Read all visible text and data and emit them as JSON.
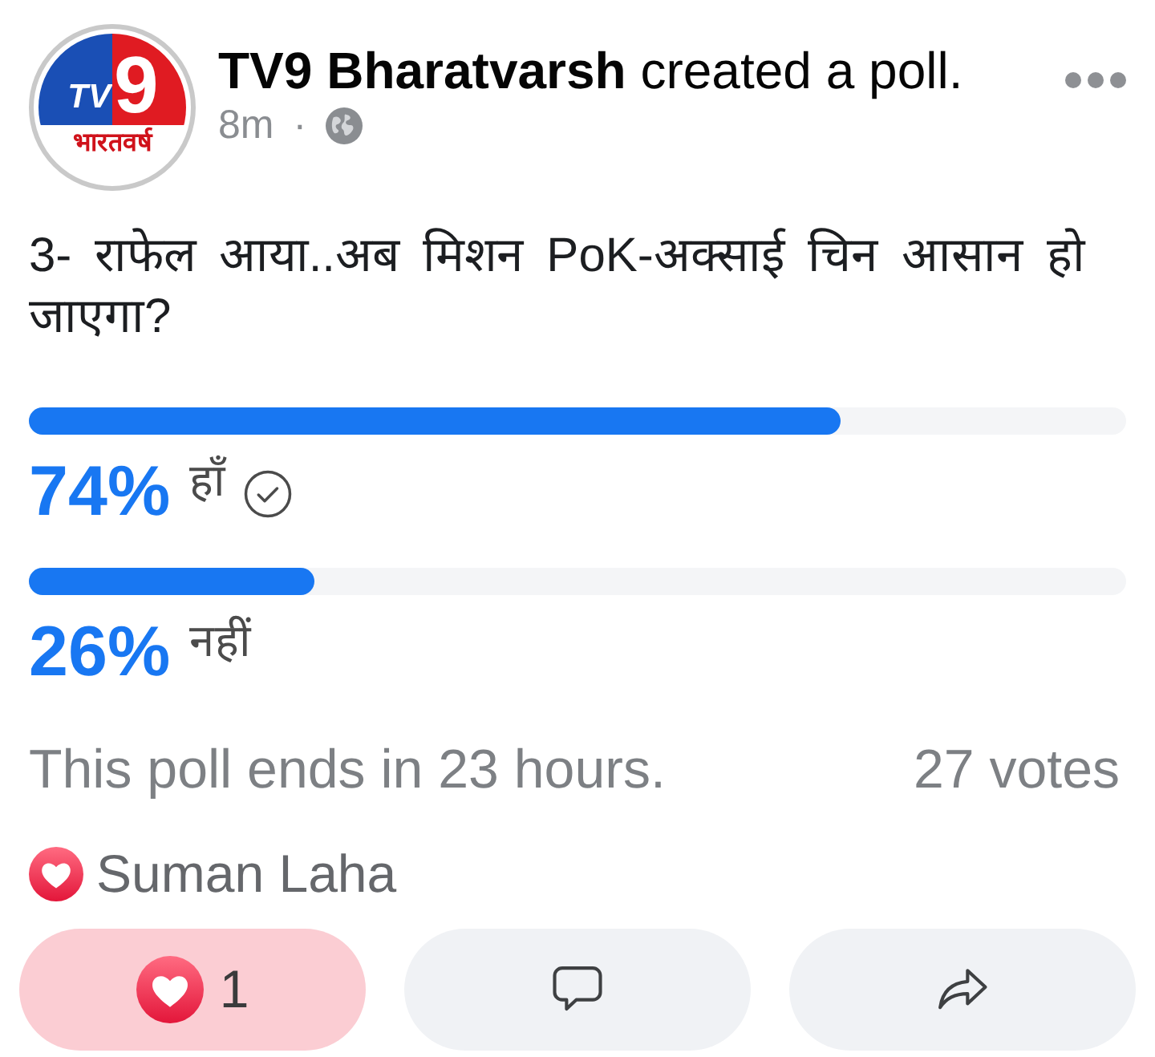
{
  "post": {
    "logo": {
      "letters": "TV",
      "numeral": "9",
      "tagline": "भारतवर्ष"
    },
    "author": "TV9 Bharatvarsh",
    "action": "created a poll.",
    "time": "8m",
    "separator": "·"
  },
  "poll": {
    "question": "3- राफेल आया..अब मिशन PoK-अक्साई चिन आसान हो जाएगा?",
    "options": [
      {
        "percent": "74%",
        "label": "हाँ",
        "level": 0.74,
        "selected": true
      },
      {
        "percent": "26%",
        "label": "नहीं",
        "level": 0.26,
        "selected": false
      }
    ],
    "ends": "This poll ends in 23 hours.",
    "votes": "27 votes"
  },
  "reactions": {
    "names": "Suman Laha"
  },
  "actions": [
    {
      "kind": "like",
      "count": "1",
      "active": true
    },
    {
      "kind": "comment",
      "active": false
    },
    {
      "kind": "share",
      "active": false
    }
  ]
}
